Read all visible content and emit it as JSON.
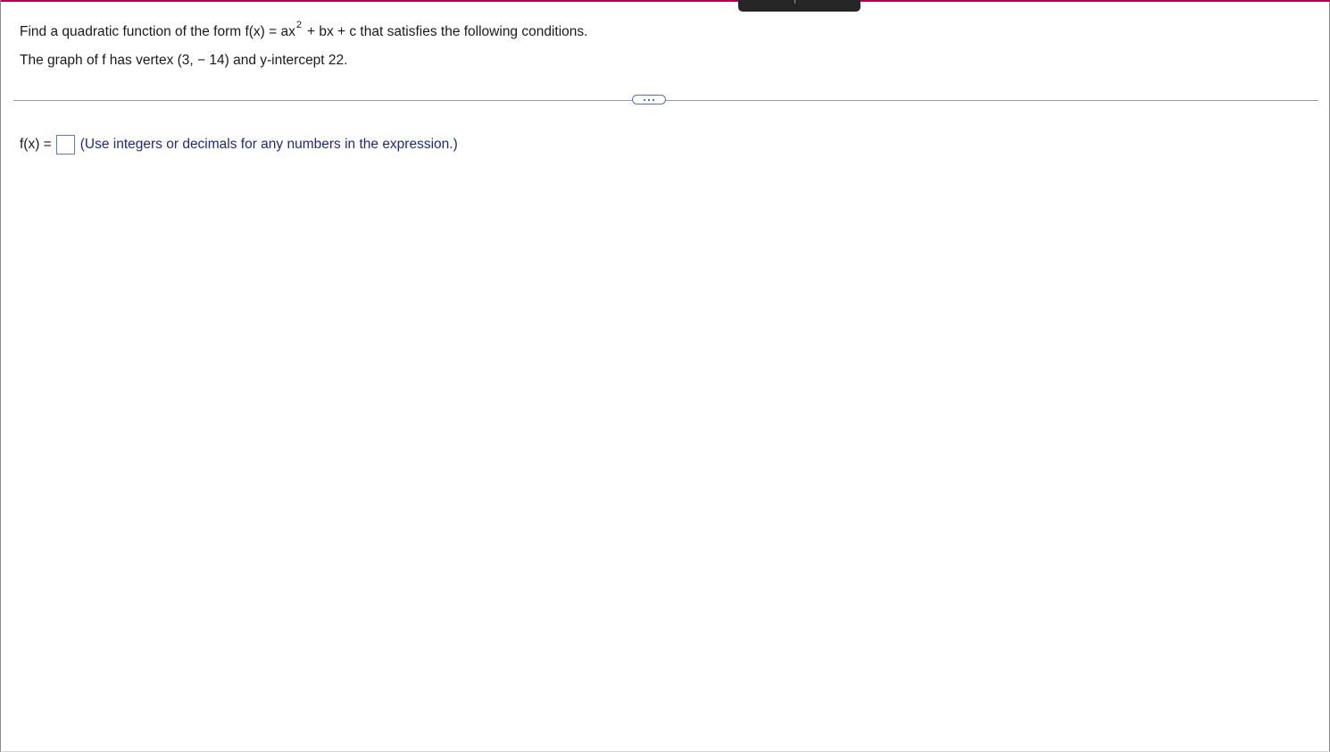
{
  "question": {
    "prefix": "Find a quadratic function of the form f(x) = ax",
    "exponent": "2",
    "suffix": "+ bx + c that satisfies the following conditions.",
    "condition": "The graph of f has vertex (3, − 14) and y-intercept 22."
  },
  "answer": {
    "label": "f(x) =",
    "value": "",
    "hint": "(Use integers or decimals for any numbers in the expression.)"
  },
  "icons": {
    "more": "more-dots-icon"
  },
  "colors": {
    "accent": "#b0004f",
    "hint_text": "#1f2a80",
    "input_border": "#5a7fc0"
  }
}
